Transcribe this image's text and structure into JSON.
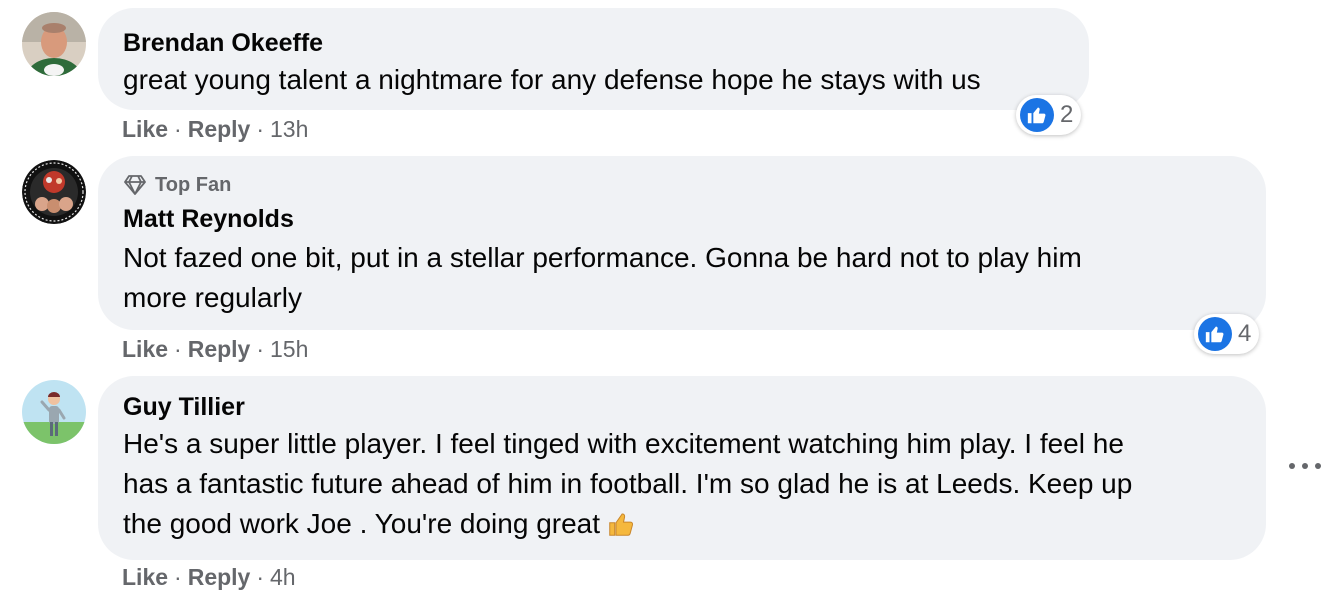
{
  "comments": [
    {
      "author": "Brendan Okeeffe",
      "text": "great young talent a nightmare for any defense hope he stays with us",
      "like_label": "Like",
      "reply_label": "Reply",
      "time": "13h",
      "reaction_count": "2"
    },
    {
      "badge": "Top Fan",
      "author": "Matt Reynolds",
      "text_line1": "Not fazed one bit, put in a stellar performance. Gonna be hard not to play him",
      "text_line2": "more regularly",
      "like_label": "Like",
      "reply_label": "Reply",
      "time": "15h",
      "reaction_count": "4"
    },
    {
      "author": "Guy Tillier",
      "text_line1": "He's a super little player. I feel tinged with excitement watching him play. I feel he",
      "text_line2": "has a fantastic future ahead of him in football. I'm so glad he is at Leeds. Keep up",
      "text_line3": "the good work Joe . You're doing great",
      "like_label": "Like",
      "reply_label": "Reply",
      "time": "4h"
    }
  ],
  "separator": "·",
  "colors": {
    "bubble": "#f0f2f5",
    "secondary_text": "#65676b",
    "like_blue": "#1b74e4"
  },
  "icons": [
    "diamond-icon",
    "like-thumb-icon",
    "thumbs-up-emoji",
    "more-options-icon"
  ]
}
